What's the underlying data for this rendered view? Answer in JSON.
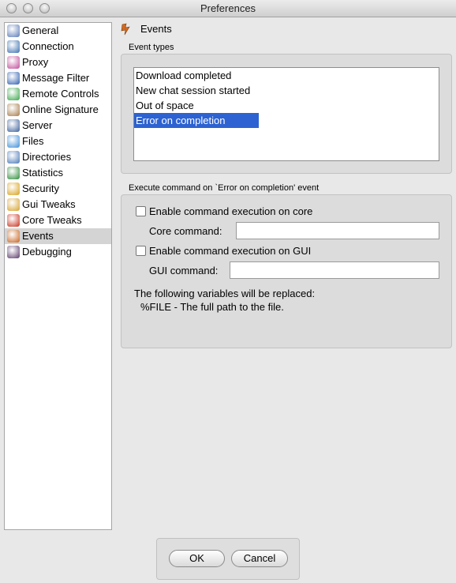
{
  "window": {
    "title": "Preferences"
  },
  "sidebar": {
    "items": [
      {
        "label": "General",
        "icon": "general-icon",
        "color": "#5b7bb6"
      },
      {
        "label": "Connection",
        "icon": "connection-icon",
        "color": "#3a6fb0"
      },
      {
        "label": "Proxy",
        "icon": "proxy-icon",
        "color": "#c04b9a"
      },
      {
        "label": "Message Filter",
        "icon": "message-filter-icon",
        "color": "#2f5fb0"
      },
      {
        "label": "Remote Controls",
        "icon": "remote-controls-icon",
        "color": "#3aa64a"
      },
      {
        "label": "Online Signature",
        "icon": "online-signature-icon",
        "color": "#a67b4a"
      },
      {
        "label": "Server",
        "icon": "server-icon",
        "color": "#3b5f9a"
      },
      {
        "label": "Files",
        "icon": "files-icon",
        "color": "#3f8ed8"
      },
      {
        "label": "Directories",
        "icon": "directories-icon",
        "color": "#4a78b8"
      },
      {
        "label": "Statistics",
        "icon": "statistics-icon",
        "color": "#2d8c3a"
      },
      {
        "label": "Security",
        "icon": "lock-icon",
        "color": "#d8a21c"
      },
      {
        "label": "Gui Tweaks",
        "icon": "gui-tweaks-icon",
        "color": "#d6a12c"
      },
      {
        "label": "Core Tweaks",
        "icon": "core-tweaks-icon",
        "color": "#c8321e"
      },
      {
        "label": "Events",
        "icon": "events-icon",
        "color": "#c8631e",
        "selected": true
      },
      {
        "label": "Debugging",
        "icon": "bug-icon",
        "color": "#5a3a6a"
      }
    ]
  },
  "pane": {
    "title": "Events",
    "event_types_label": "Event types",
    "event_types": [
      {
        "label": "Download completed"
      },
      {
        "label": "New chat session started"
      },
      {
        "label": "Out of space"
      },
      {
        "label": "Error on completion",
        "selected": true
      }
    ],
    "execute_label": "Execute command on `Error on completion' event",
    "core_checkbox_label": "Enable command execution on core",
    "core_command_label": "Core command:",
    "core_command_value": "",
    "gui_checkbox_label": "Enable command execution on GUI",
    "gui_command_label": "GUI command:",
    "gui_command_value": "",
    "variables_note": "The following variables will be replaced:",
    "variables_item": "%FILE - The full path to the file."
  },
  "buttons": {
    "ok": "OK",
    "cancel": "Cancel"
  },
  "colors": {
    "selection": "#2c62d1",
    "sidebar_selected": "#d4d4d4",
    "panel": "#dcdcdc"
  }
}
